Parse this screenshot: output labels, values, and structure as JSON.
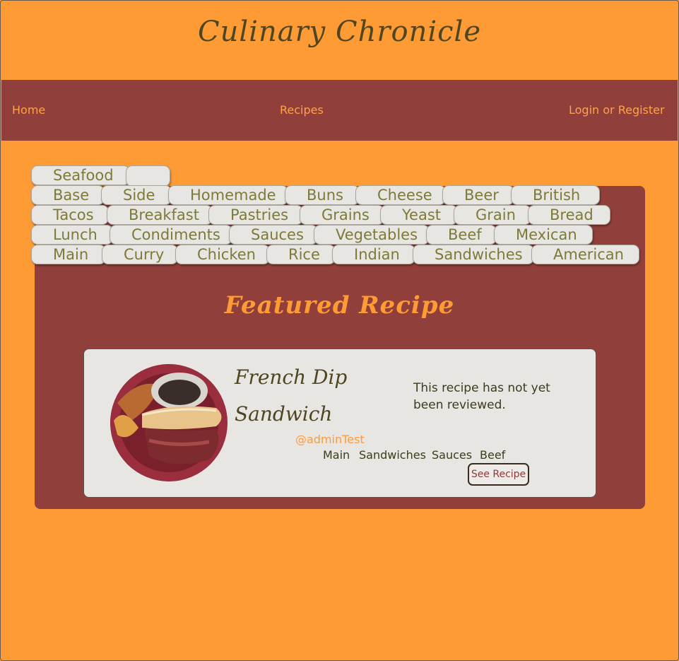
{
  "site": {
    "title": "Culinary Chronicle"
  },
  "nav": {
    "home": "Home",
    "recipes": "Recipes",
    "login": "Login or Register"
  },
  "tag_rows": [
    [
      "Seafood",
      ""
    ],
    [
      "Base",
      "Side",
      "Homemade",
      "Buns",
      "Cheese",
      "Beer",
      "British"
    ],
    [
      "Tacos",
      "Breakfast",
      "Pastries",
      "Grains",
      "Yeast",
      "Grain",
      "Bread"
    ],
    [
      "Lunch",
      "Condiments",
      "Sauces",
      "Vegetables",
      "Beef",
      "Mexican"
    ],
    [
      "Main",
      "Curry",
      "Chicken",
      "Rice",
      "Indian",
      "Sandwiches",
      "American"
    ]
  ],
  "featured": {
    "heading": "Featured Recipe",
    "recipe_name": "French Dip Sandwich",
    "review_status": "This recipe has not yet been reviewed.",
    "author": "@adminTest",
    "tags": [
      "Main",
      "Sandwiches",
      "Sauces",
      "Beef"
    ],
    "button": "See Recipe"
  },
  "colors": {
    "background": "#ff9b35",
    "nav_panel": "#913f3b",
    "tag_bg": "#e8e6e3",
    "tag_text": "#7d7a39"
  }
}
